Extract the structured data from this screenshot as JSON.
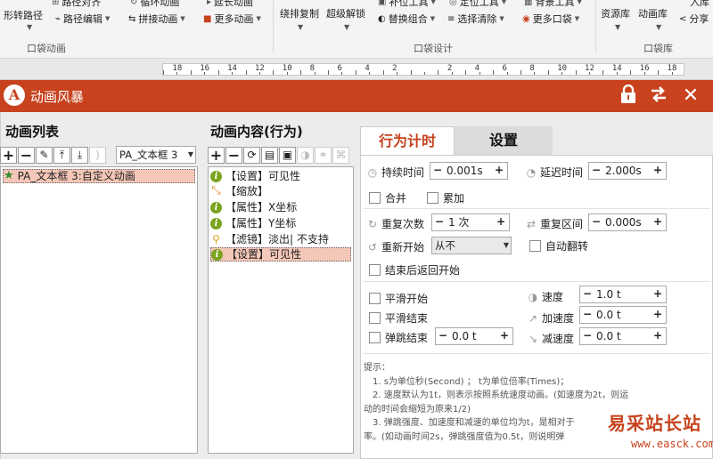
{
  "ribbon": {
    "row1": [
      "路径对齐",
      "循环动画",
      "延长动画",
      "补位工具",
      "定位工具",
      "背景工具",
      "入库"
    ],
    "row2": [
      {
        "icon": "",
        "label": "形转路径"
      },
      {
        "icon": "⌁",
        "label": "路径编辑"
      },
      {
        "icon": "⇆",
        "label": "拼接动画"
      },
      {
        "icon": "■",
        "label": "更多动画"
      },
      {
        "icon": "",
        "label": "绕排复制"
      },
      {
        "icon": "",
        "label": "超级解锁"
      },
      {
        "icon": "◐",
        "label": "替换组合"
      },
      {
        "icon": "≡",
        "label": "选择清除"
      },
      {
        "icon": "◉",
        "label": "更多口袋"
      },
      {
        "icon": "",
        "label": "资源库"
      },
      {
        "icon": "",
        "label": "动画库"
      },
      {
        "icon": "<",
        "label": "分享"
      }
    ],
    "groups": [
      "口袋动画",
      "口袋设计",
      "口袋库"
    ]
  },
  "ruler": {
    "labels": [
      "18",
      "16",
      "14",
      "12",
      "10",
      "8",
      "6",
      "4",
      "2",
      "",
      "2",
      "4",
      "6",
      "8",
      "10",
      "12",
      "14",
      "16",
      "18"
    ]
  },
  "dialog": {
    "title": "动画风暴",
    "anim_list": {
      "title": "动画列表",
      "toolbar": [
        "+",
        "−",
        "✎",
        "⤒",
        "⤓",
        ")"
      ],
      "object_select": "PA_文本框 3",
      "items": [
        {
          "icon": "star-icon",
          "label": "PA_文本框 3:自定义动画"
        }
      ]
    },
    "anim_content": {
      "title": "动画内容(行为)",
      "toolbar": [
        "+",
        "−",
        "⟳",
        "▤",
        "▣",
        "◑",
        "⚭",
        "⌘"
      ],
      "items": [
        {
          "icon": "info",
          "label": "【设置】可见性"
        },
        {
          "icon": "scale",
          "label": "【缩放】"
        },
        {
          "icon": "info",
          "label": "【属性】X坐标"
        },
        {
          "icon": "info",
          "label": "【属性】Y坐标"
        },
        {
          "icon": "lens",
          "label": "【滤镜】淡出| 不支持"
        },
        {
          "icon": "info",
          "label": "【设置】可见性"
        }
      ]
    },
    "tabs": {
      "timing": "行为计时",
      "settings": "设置"
    },
    "timing": {
      "duration_label": "持续时间",
      "duration_value": "0.001s",
      "delay_label": "延迟时间",
      "delay_value": "2.000s",
      "merge_label": "合并",
      "accumulate_label": "累加",
      "repeat_label": "重复次数",
      "repeat_value": "1 次",
      "repeat_range_label": "重复区间",
      "repeat_range_value": "0.000s",
      "restart_label": "重新开始",
      "restart_value": "从不",
      "auto_reverse_label": "自动翻转",
      "return_label": "结束后返回开始",
      "smooth_start_label": "平滑开始",
      "smooth_end_label": "平滑结束",
      "bounce_end_label": "弹跳结束",
      "bounce_value": "0.0 t",
      "speed_label": "速度",
      "speed_value": "1.0 t",
      "accel_label": "加速度",
      "accel_value": "0.0 t",
      "decel_label": "减速度",
      "decel_value": "0.0 t",
      "minus": "−",
      "plus": "+"
    },
    "notes": {
      "title": "提示：",
      "line1": "1. s为单位秒(Second) ； t为单位倍率(Times)；",
      "line2": "2. 速度默认为1t，则表示按照系统速度动画。(如速度为2t，则运",
      "line3": "动的时间会缩短为原来1/2)",
      "line4": "3. 弹跳强度、加速度和减速的单位均为t，是相对于",
      "line5": "率。(如动画时间2s，弹跳强度值为0.5t，则说明弹"
    }
  },
  "watermark": {
    "cn": "易采站长站",
    "url": "www.easck.com"
  },
  "colors": {
    "accent": "#c7421d",
    "selection": "#f5c7b8",
    "info_icon": "#7aa41e"
  }
}
